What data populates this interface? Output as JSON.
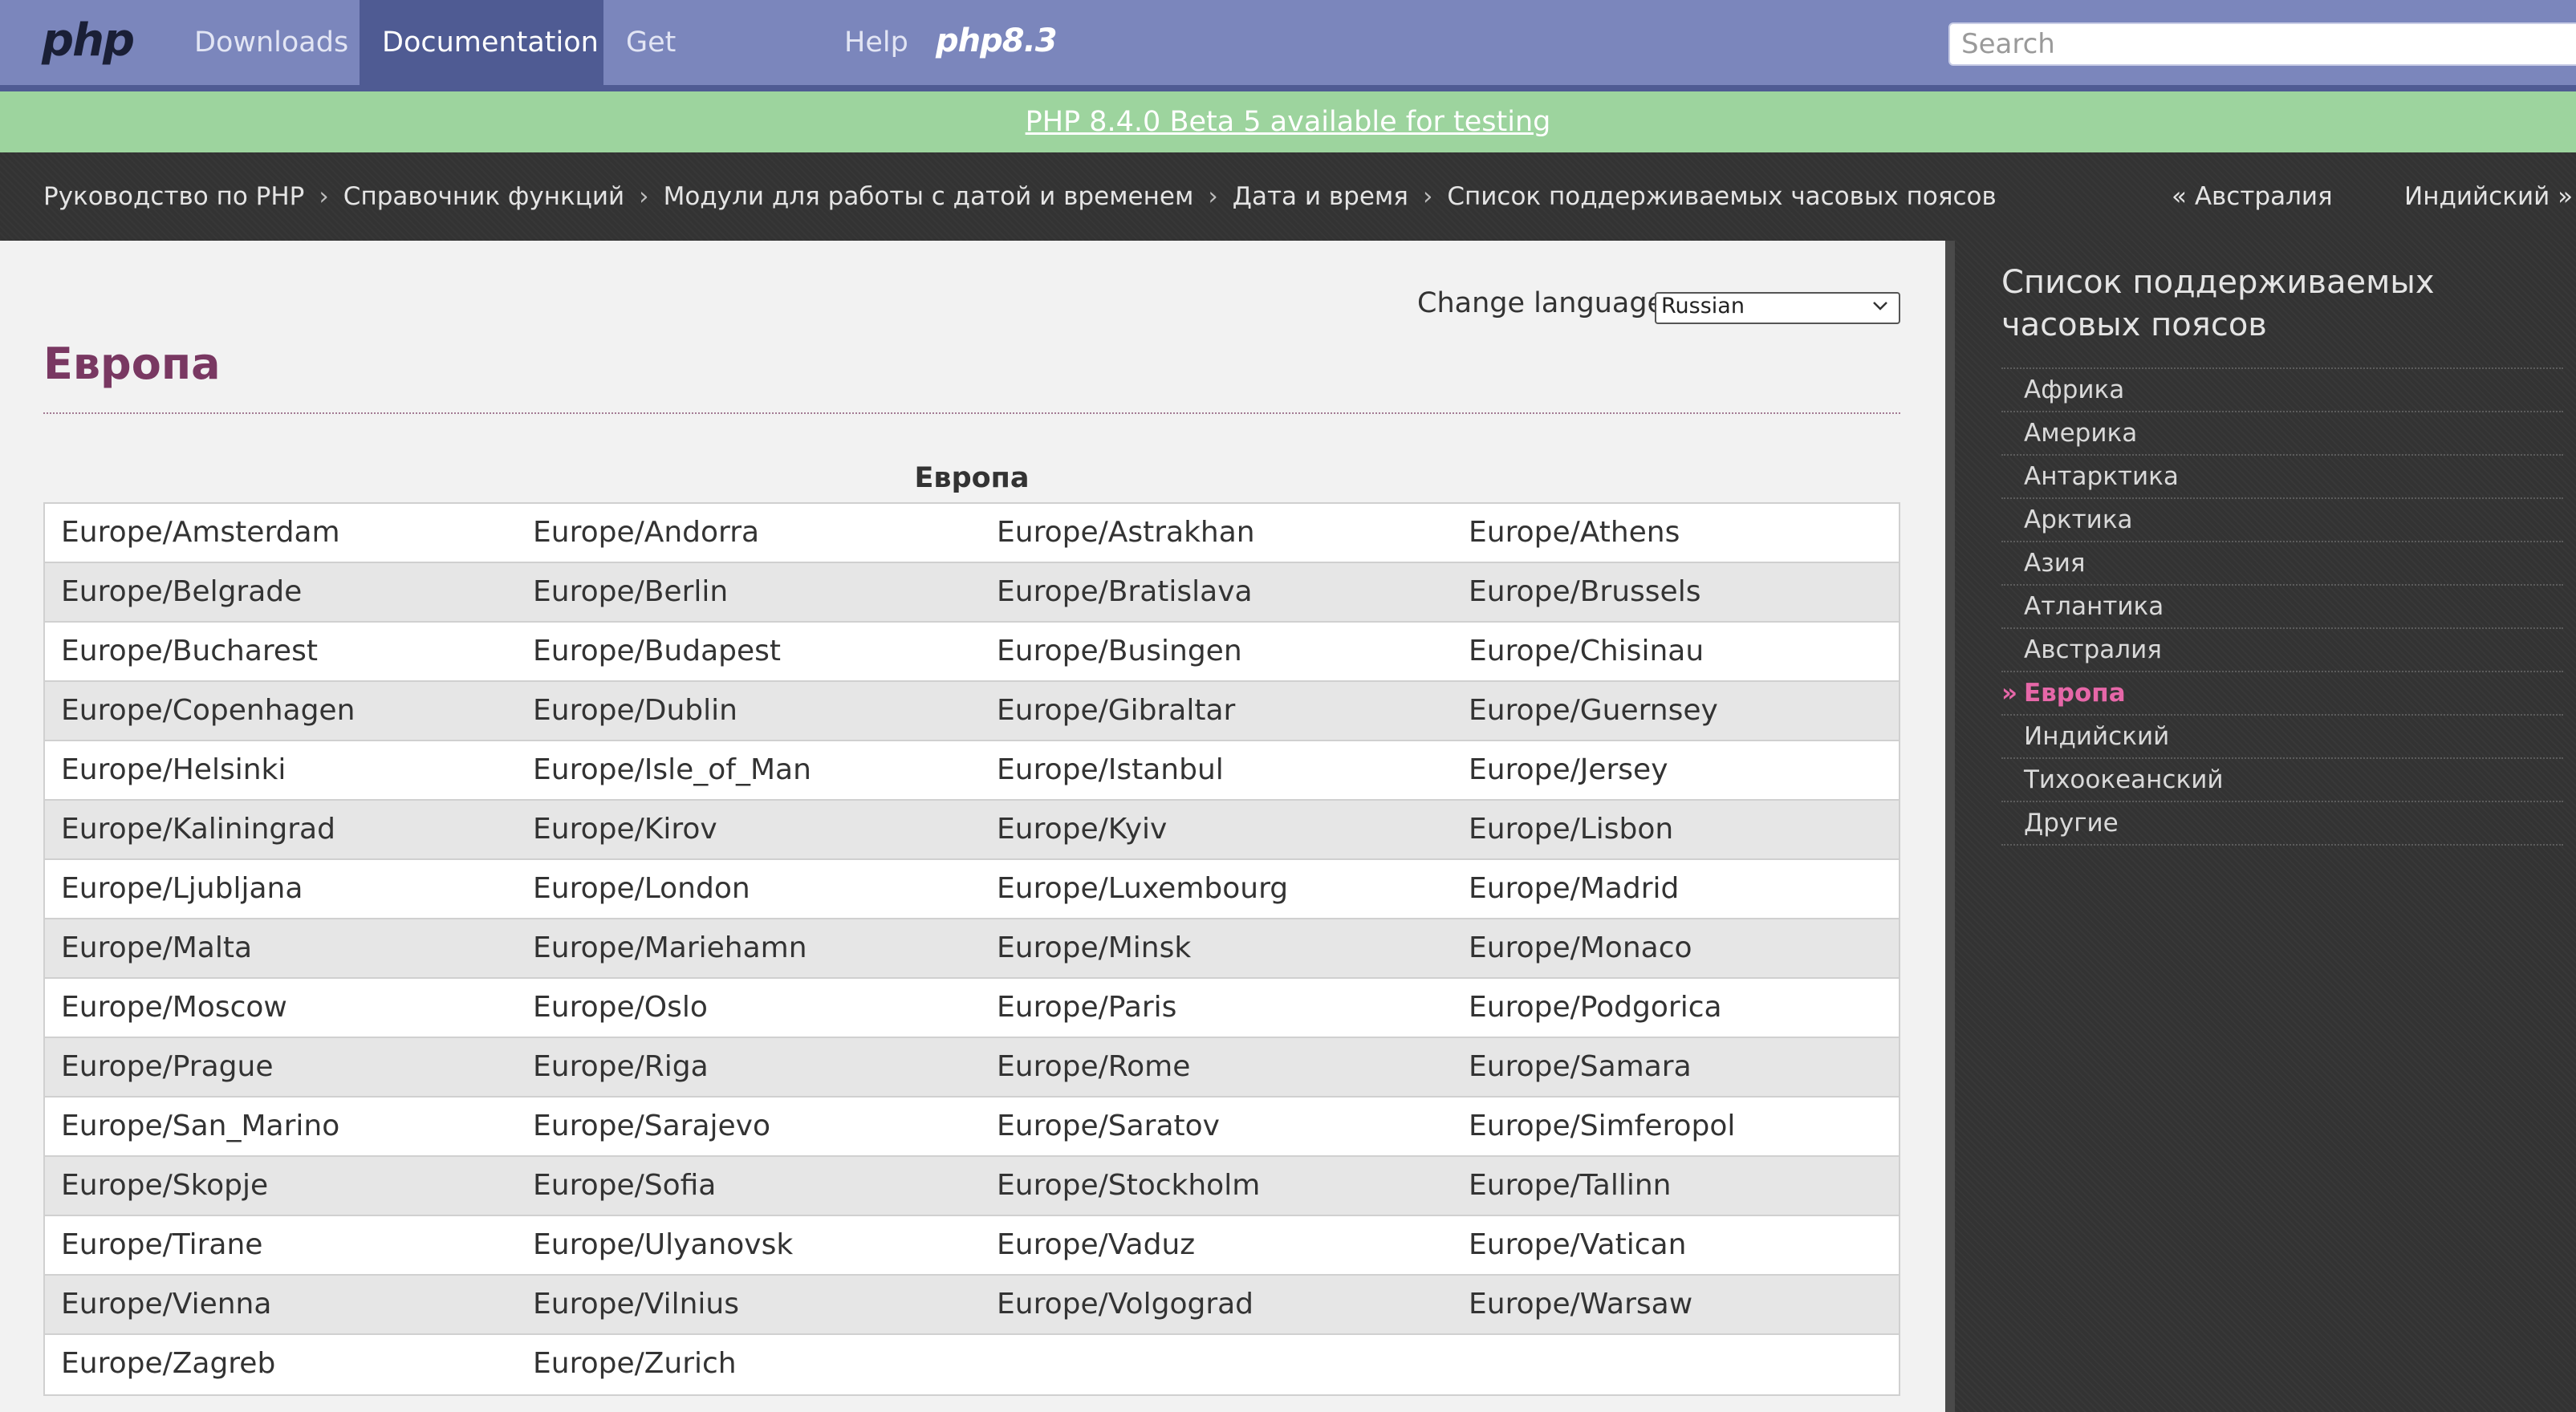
{
  "header": {
    "logo": "php",
    "nav": [
      {
        "label": "Downloads",
        "active": false
      },
      {
        "label": "Documentation",
        "active": true
      },
      {
        "label": "Get Involved",
        "active": false
      },
      {
        "label": "Help",
        "active": false
      }
    ],
    "version_logo": "php8.3",
    "search": {
      "placeholder": "Search",
      "value": ""
    }
  },
  "announcement": {
    "text": "PHP 8.4.0 Beta 5 available for testing"
  },
  "breadcrumb": {
    "items": [
      "Руководство по PHP",
      "Справочник функций",
      "Модули для работы с датой и временем",
      "Дата и время",
      "Список поддерживаемых часовых поясов"
    ],
    "prev": "« Австралия",
    "next": "Индийский »"
  },
  "main": {
    "change_language_label": "Change language:",
    "language_selected": "Russian",
    "title": "Европа",
    "table_caption": "Европа",
    "rows": [
      [
        "Europe/Amsterdam",
        "Europe/Andorra",
        "Europe/Astrakhan",
        "Europe/Athens"
      ],
      [
        "Europe/Belgrade",
        "Europe/Berlin",
        "Europe/Bratislava",
        "Europe/Brussels"
      ],
      [
        "Europe/Bucharest",
        "Europe/Budapest",
        "Europe/Busingen",
        "Europe/Chisinau"
      ],
      [
        "Europe/Copenhagen",
        "Europe/Dublin",
        "Europe/Gibraltar",
        "Europe/Guernsey"
      ],
      [
        "Europe/Helsinki",
        "Europe/Isle_of_Man",
        "Europe/Istanbul",
        "Europe/Jersey"
      ],
      [
        "Europe/Kaliningrad",
        "Europe/Kirov",
        "Europe/Kyiv",
        "Europe/Lisbon"
      ],
      [
        "Europe/Ljubljana",
        "Europe/London",
        "Europe/Luxembourg",
        "Europe/Madrid"
      ],
      [
        "Europe/Malta",
        "Europe/Mariehamn",
        "Europe/Minsk",
        "Europe/Monaco"
      ],
      [
        "Europe/Moscow",
        "Europe/Oslo",
        "Europe/Paris",
        "Europe/Podgorica"
      ],
      [
        "Europe/Prague",
        "Europe/Riga",
        "Europe/Rome",
        "Europe/Samara"
      ],
      [
        "Europe/San_Marino",
        "Europe/Sarajevo",
        "Europe/Saratov",
        "Europe/Simferopol"
      ],
      [
        "Europe/Skopje",
        "Europe/Sofia",
        "Europe/Stockholm",
        "Europe/Tallinn"
      ],
      [
        "Europe/Tirane",
        "Europe/Ulyanovsk",
        "Europe/Vaduz",
        "Europe/Vatican"
      ],
      [
        "Europe/Vienna",
        "Europe/Vilnius",
        "Europe/Volgograd",
        "Europe/Warsaw"
      ],
      [
        "Europe/Zagreb",
        "Europe/Zurich",
        "",
        ""
      ]
    ]
  },
  "sidebar": {
    "title": "Список поддерживаемых часовых поясов",
    "current_marker": "»",
    "items": [
      {
        "label": "Африка",
        "current": false
      },
      {
        "label": "Америка",
        "current": false
      },
      {
        "label": "Антарктика",
        "current": false
      },
      {
        "label": "Арктика",
        "current": false
      },
      {
        "label": "Азия",
        "current": false
      },
      {
        "label": "Атлантика",
        "current": false
      },
      {
        "label": "Австралия",
        "current": false
      },
      {
        "label": "Европа",
        "current": true
      },
      {
        "label": "Индийский",
        "current": false
      },
      {
        "label": "Тихоокеанский",
        "current": false
      },
      {
        "label": "Другие",
        "current": false
      }
    ]
  },
  "colors": {
    "nav_bg": "#7b86bc",
    "nav_active_bg": "#4f5b93",
    "announce_bg": "#9dd49e",
    "dark_bg": "#333333",
    "title_color": "#793862",
    "sidebar_current": "#e667a8"
  }
}
